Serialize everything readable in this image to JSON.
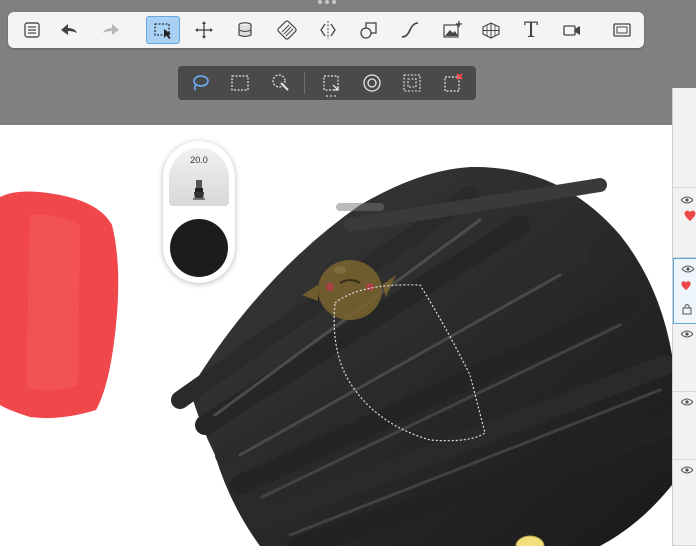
{
  "main_toolbar": {
    "tools": [
      {
        "name": "layer-list-button",
        "icon": "list-icon"
      },
      {
        "name": "undo-button",
        "icon": "undo-arrow-icon"
      },
      {
        "name": "redo-button",
        "icon": "redo-arrow-icon",
        "disabled": true
      },
      {
        "name": "selection-tool-button",
        "icon": "selection-cursor-icon",
        "active": true
      },
      {
        "name": "move-tool-button",
        "icon": "move-arrows-icon"
      },
      {
        "name": "fill-tool-button",
        "icon": "paint-bucket-icon"
      },
      {
        "name": "gradient-tool-button",
        "icon": "gradient-stripes-icon"
      },
      {
        "name": "symmetry-tool-button",
        "icon": "symmetry-icon"
      },
      {
        "name": "shapes-tool-button",
        "icon": "shapes-icon"
      },
      {
        "name": "curve-tool-button",
        "icon": "curve-icon"
      },
      {
        "name": "insert-image-button",
        "icon": "image-add-icon"
      },
      {
        "name": "perspective-tool-button",
        "icon": "perspective-grid-icon"
      },
      {
        "name": "text-tool-button",
        "icon": "text-icon"
      },
      {
        "name": "record-video-button",
        "icon": "video-camera-icon"
      },
      {
        "name": "fullscreen-button",
        "icon": "fullscreen-icon"
      }
    ],
    "text_tool_glyph": "T"
  },
  "selection_toolbar": {
    "tools": [
      {
        "name": "lasso-select-button",
        "icon": "lasso-icon",
        "active": true
      },
      {
        "name": "rectangle-select-button",
        "icon": "rectangle-select-icon"
      },
      {
        "name": "magic-wand-button",
        "icon": "magic-wand-icon"
      },
      {
        "name": "selection-modify-button",
        "icon": "selection-modify-icon"
      },
      {
        "name": "feather-selection-button",
        "icon": "target-icon"
      },
      {
        "name": "invert-selection-button",
        "icon": "invert-selection-icon"
      },
      {
        "name": "clear-selection-button",
        "icon": "clear-selection-icon"
      }
    ]
  },
  "brush_panel": {
    "size_value": "20.0",
    "current_color": "#1c1c1c"
  },
  "colors": {
    "active_tool_bg": "#a9d0f5",
    "red_stroke": "#f0474a",
    "black_stroke": "#1f1f1f"
  }
}
